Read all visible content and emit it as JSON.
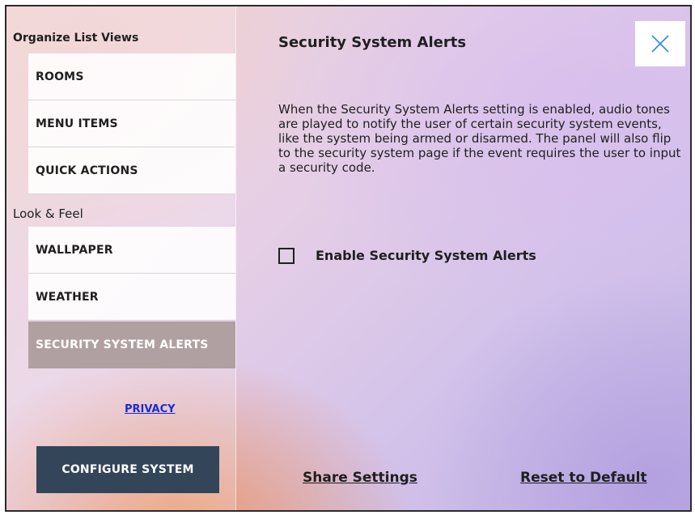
{
  "sidebar": {
    "sections": [
      {
        "header": "Organize List Views",
        "items": [
          {
            "label": "ROOMS"
          },
          {
            "label": "MENU ITEMS"
          },
          {
            "label": "QUICK ACTIONS"
          }
        ]
      },
      {
        "header": "Look & Feel",
        "items": [
          {
            "label": "WALLPAPER"
          },
          {
            "label": "WEATHER"
          },
          {
            "label": "SECURITY SYSTEM ALERTS",
            "active": true
          }
        ]
      }
    ],
    "privacy_link": "PRIVACY",
    "configure_button": "CONFIGURE SYSTEM"
  },
  "main": {
    "title": "Security System Alerts",
    "description": "When the Security System Alerts setting is enabled, audio tones are played to notify the user of certain security system events, like the system being armed or disarmed. The panel will also flip to the security system page if the event requires the user to input a security code.",
    "checkbox": {
      "label": "Enable Security System Alerts",
      "checked": false
    },
    "footer": {
      "share_settings": "Share Settings",
      "reset_to_default": "Reset to Default"
    }
  },
  "icons": {
    "close": "close-icon"
  },
  "colors": {
    "active_item": "#a69694",
    "configure_button": "#334558",
    "privacy_link": "#1a2bd6",
    "close_icon": "#3a8fd8"
  }
}
